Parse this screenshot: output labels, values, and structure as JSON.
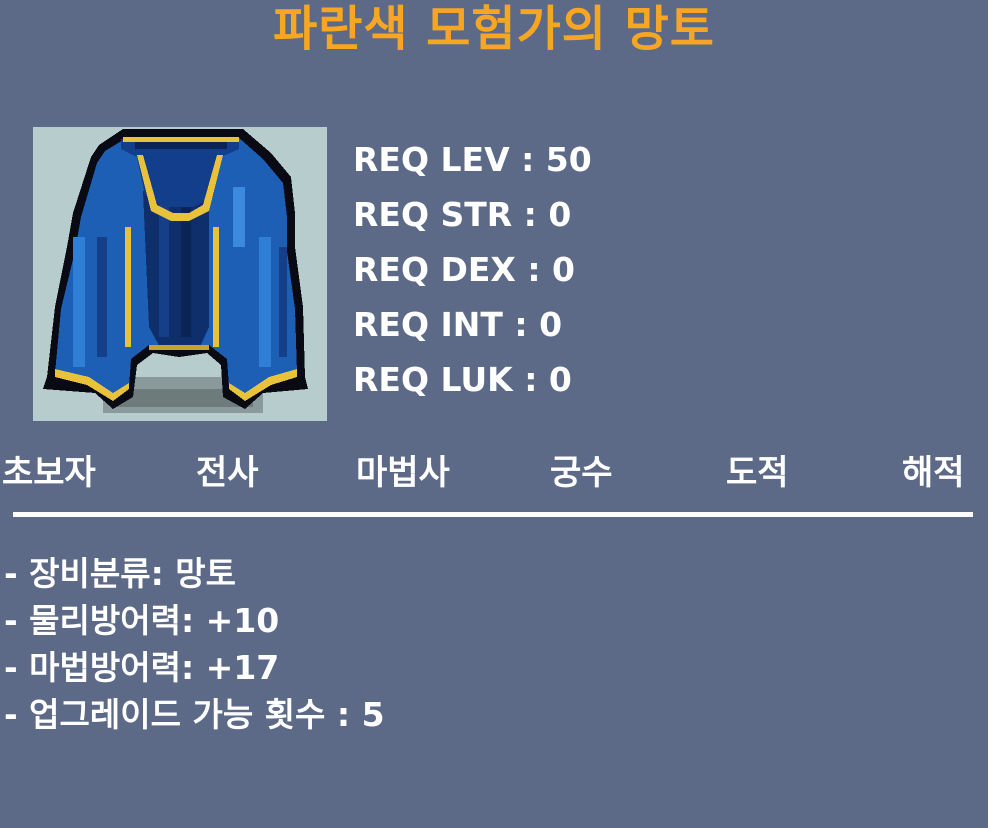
{
  "title": "파란색 모험가의 망토",
  "item": {
    "icon": "blue-cape-icon"
  },
  "requirements": [
    "REQ LEV : 50",
    "REQ STR : 0",
    "REQ DEX : 0",
    "REQ INT : 0",
    "REQ LUK : 0"
  ],
  "jobs": [
    "초보자",
    "전사",
    "마법사",
    "궁수",
    "도적",
    "해적"
  ],
  "stats": [
    "- 장비분류: 망토",
    "- 물리방어력: +10",
    "- 마법방어력: +17",
    "- 업그레이드 가능 횟수 : 5"
  ],
  "colors": {
    "background": "#5c6a88",
    "title": "#f6a623",
    "text": "#ffffff",
    "image_background": "#b7cccc"
  }
}
